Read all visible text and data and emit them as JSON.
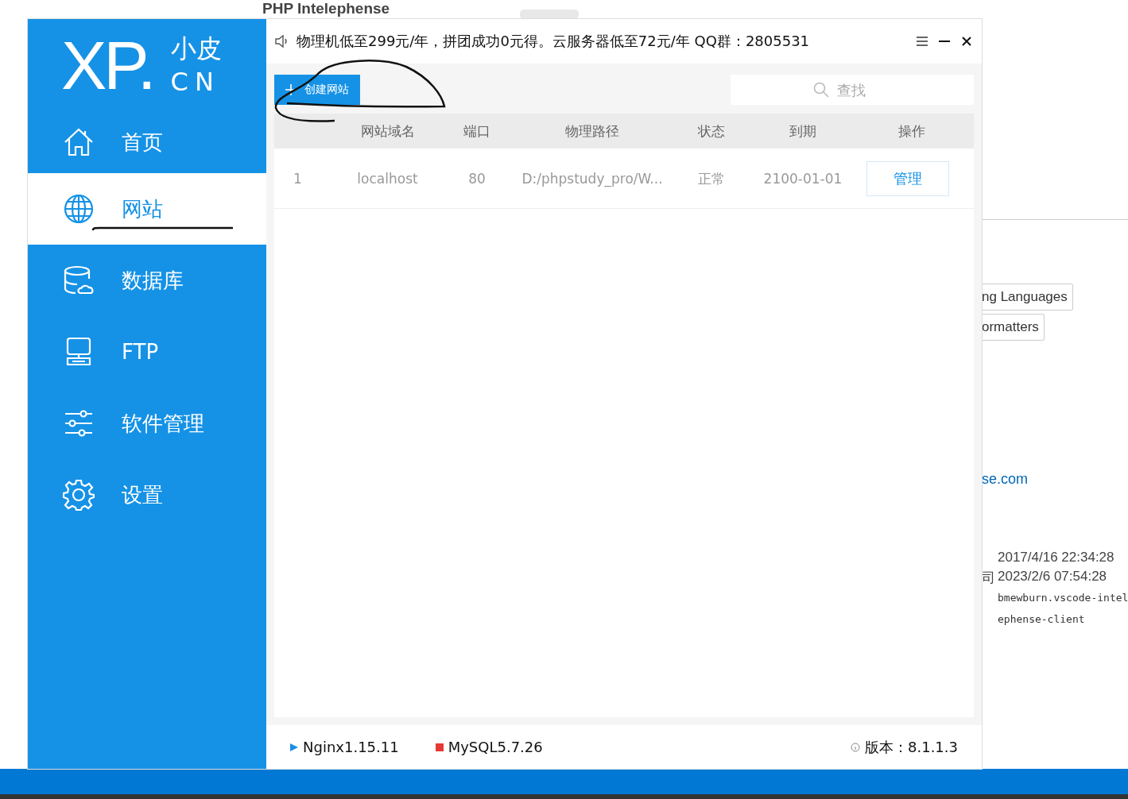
{
  "background_page": {
    "heading": "PHP Intelephense",
    "tags": [
      "ng Languages",
      "ormatters"
    ],
    "link": "se.com",
    "details": [
      {
        "value": "2017/4/16 22:34:28"
      },
      {
        "label": "司",
        "value": "2023/2/6 07:54:28"
      }
    ],
    "identifier": "bmewburn.vscode-intelephense-client"
  },
  "app": {
    "logo": {
      "mark": "XP.",
      "title": "小皮",
      "domain": "CN"
    },
    "sidebar": {
      "items": [
        {
          "kind": "home",
          "label": "首页",
          "selected": false
        },
        {
          "kind": "globe",
          "label": "网站",
          "selected": true
        },
        {
          "kind": "database",
          "label": "数据库",
          "selected": false
        },
        {
          "kind": "monitor",
          "label": "FTP",
          "selected": false
        },
        {
          "kind": "sliders",
          "label": "软件管理",
          "selected": false
        },
        {
          "kind": "gear",
          "label": "设置",
          "selected": false
        }
      ]
    },
    "notice": "物理机低至299元/年，拼团成功0元得。云服务器低至72元/年  QQ群：2805531",
    "toolbar": {
      "create_button": "创建网站",
      "search": {
        "placeholder": "查找"
      }
    },
    "table": {
      "columns": [
        "",
        "网站域名",
        "端口",
        "物理路径",
        "状态",
        "到期",
        "操作"
      ],
      "rows": [
        {
          "cells": [
            "1",
            "localhost",
            "80",
            "D:/phpstudy_pro/W...",
            "正常",
            "2100-01-01"
          ],
          "action": "管理"
        }
      ]
    },
    "status_bar": {
      "services": [
        {
          "name": "Nginx1.15.11",
          "kind": "triangle",
          "color": "#1a8fe3"
        },
        {
          "name": "MySQL5.7.26",
          "kind": "square",
          "color": "#e53935"
        }
      ],
      "version": "版本：8.1.1.3"
    }
  }
}
